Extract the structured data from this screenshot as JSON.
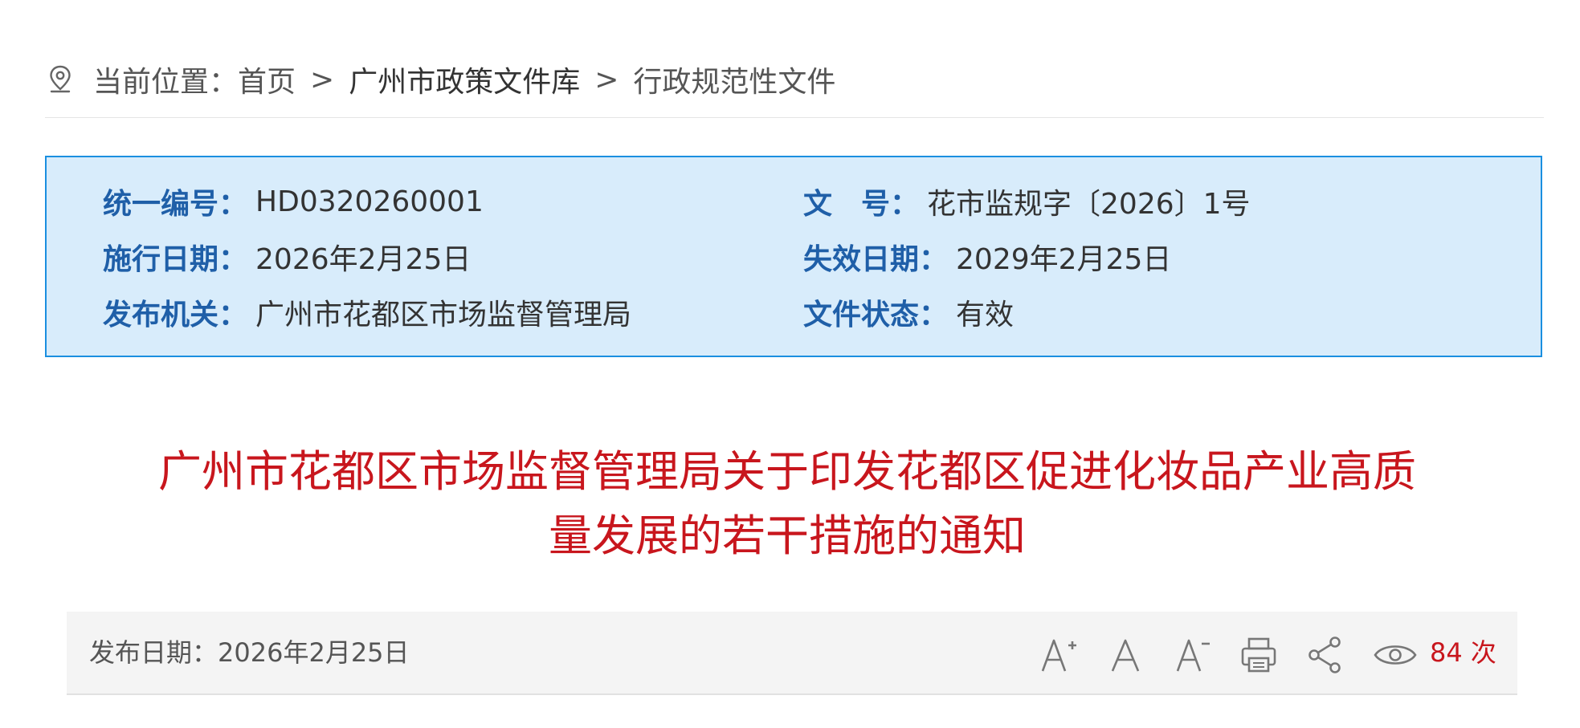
{
  "breadcrumb": {
    "prefix": "当前位置：",
    "items": [
      "首页",
      "广州市政策文件库",
      "行政规范性文件"
    ],
    "separator": ">"
  },
  "info": {
    "serial_label": "统一编号",
    "serial_value": "HD0320260001",
    "docno_label": "文号",
    "docno_value": "花市监规字〔2026〕1号",
    "effective_label": "施行日期",
    "effective_value": "2026年2月25日",
    "expiry_label": "失效日期",
    "expiry_value": "2029年2月25日",
    "issuer_label": "发布机关",
    "issuer_value": "广州市花都区市场监督管理局",
    "status_label": "文件状态",
    "status_value": "有效",
    "colon": "："
  },
  "title": {
    "line1": "广州市花都区市场监督管理局关于印发花都区促进化妆品产业高质",
    "line2": "量发展的若干措施的通知"
  },
  "toolbar": {
    "pubdate_label": "发布日期：",
    "pubdate_value": "2026年2月25日",
    "views_count": "84",
    "views_unit": "次",
    "icons": [
      "font-increase-icon",
      "font-reset-icon",
      "font-decrease-icon",
      "print-icon",
      "share-icon",
      "eye-icon"
    ]
  },
  "colors": {
    "title_red": "#c8161d",
    "label_blue": "#1f5fa8",
    "box_bg": "#d8ecfb",
    "box_border": "#1a8fe0"
  }
}
